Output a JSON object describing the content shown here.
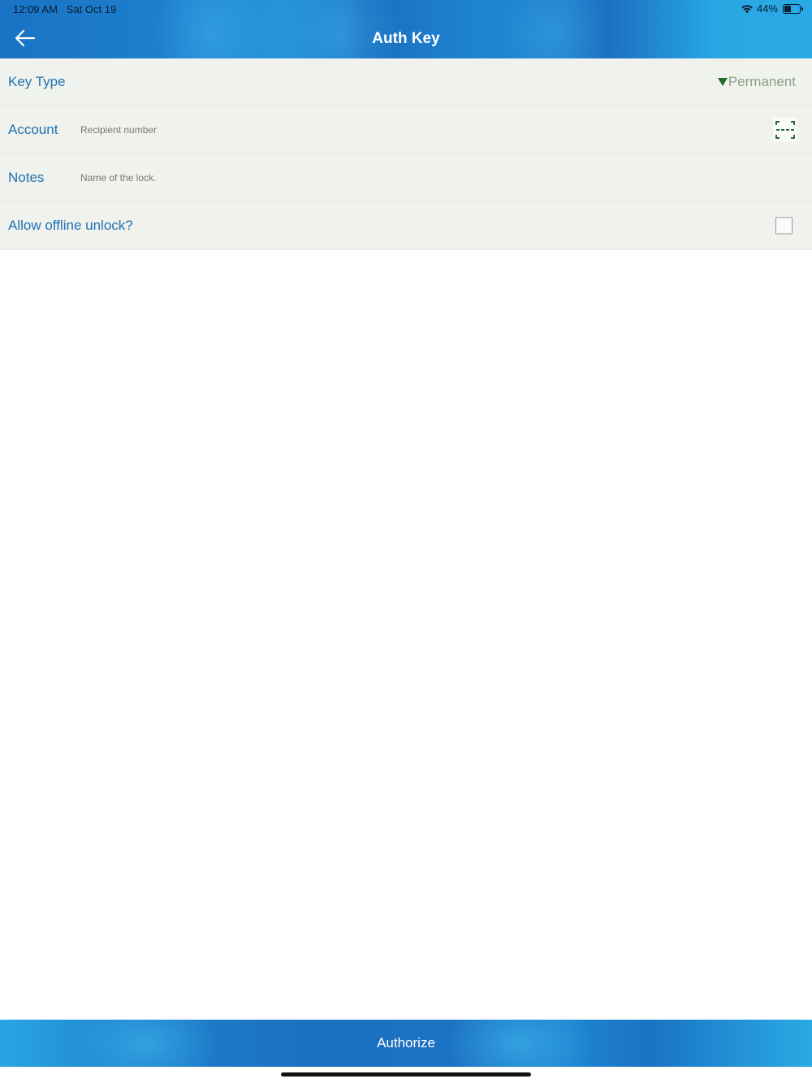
{
  "status_bar": {
    "time": "12:09 AM",
    "date": "Sat Oct 19",
    "battery_percent": "44%",
    "battery_level": 0.44,
    "icons": [
      "wifi-icon",
      "battery-icon"
    ]
  },
  "header": {
    "title": "Auth Key",
    "back_icon": "back-arrow-icon"
  },
  "form": {
    "key_type": {
      "label": "Key Type",
      "value": "Permanent",
      "caret_icon": "triangle-down-icon"
    },
    "account": {
      "label": "Account",
      "value": "",
      "placeholder": "Recipient number",
      "scan_icon": "scan-icon"
    },
    "notes": {
      "label": "Notes",
      "value": "",
      "placeholder": "Name of the lock."
    },
    "offline_unlock": {
      "label": "Allow offline unlock?",
      "checked": false
    }
  },
  "footer": {
    "authorize_label": "Authorize"
  },
  "colors": {
    "header_blue": "#1a73c4",
    "label_blue": "#1f72b4",
    "form_background": "#f0f2ee",
    "dropdown_caret": "#276b2a",
    "dropdown_value": "#8ea084"
  }
}
